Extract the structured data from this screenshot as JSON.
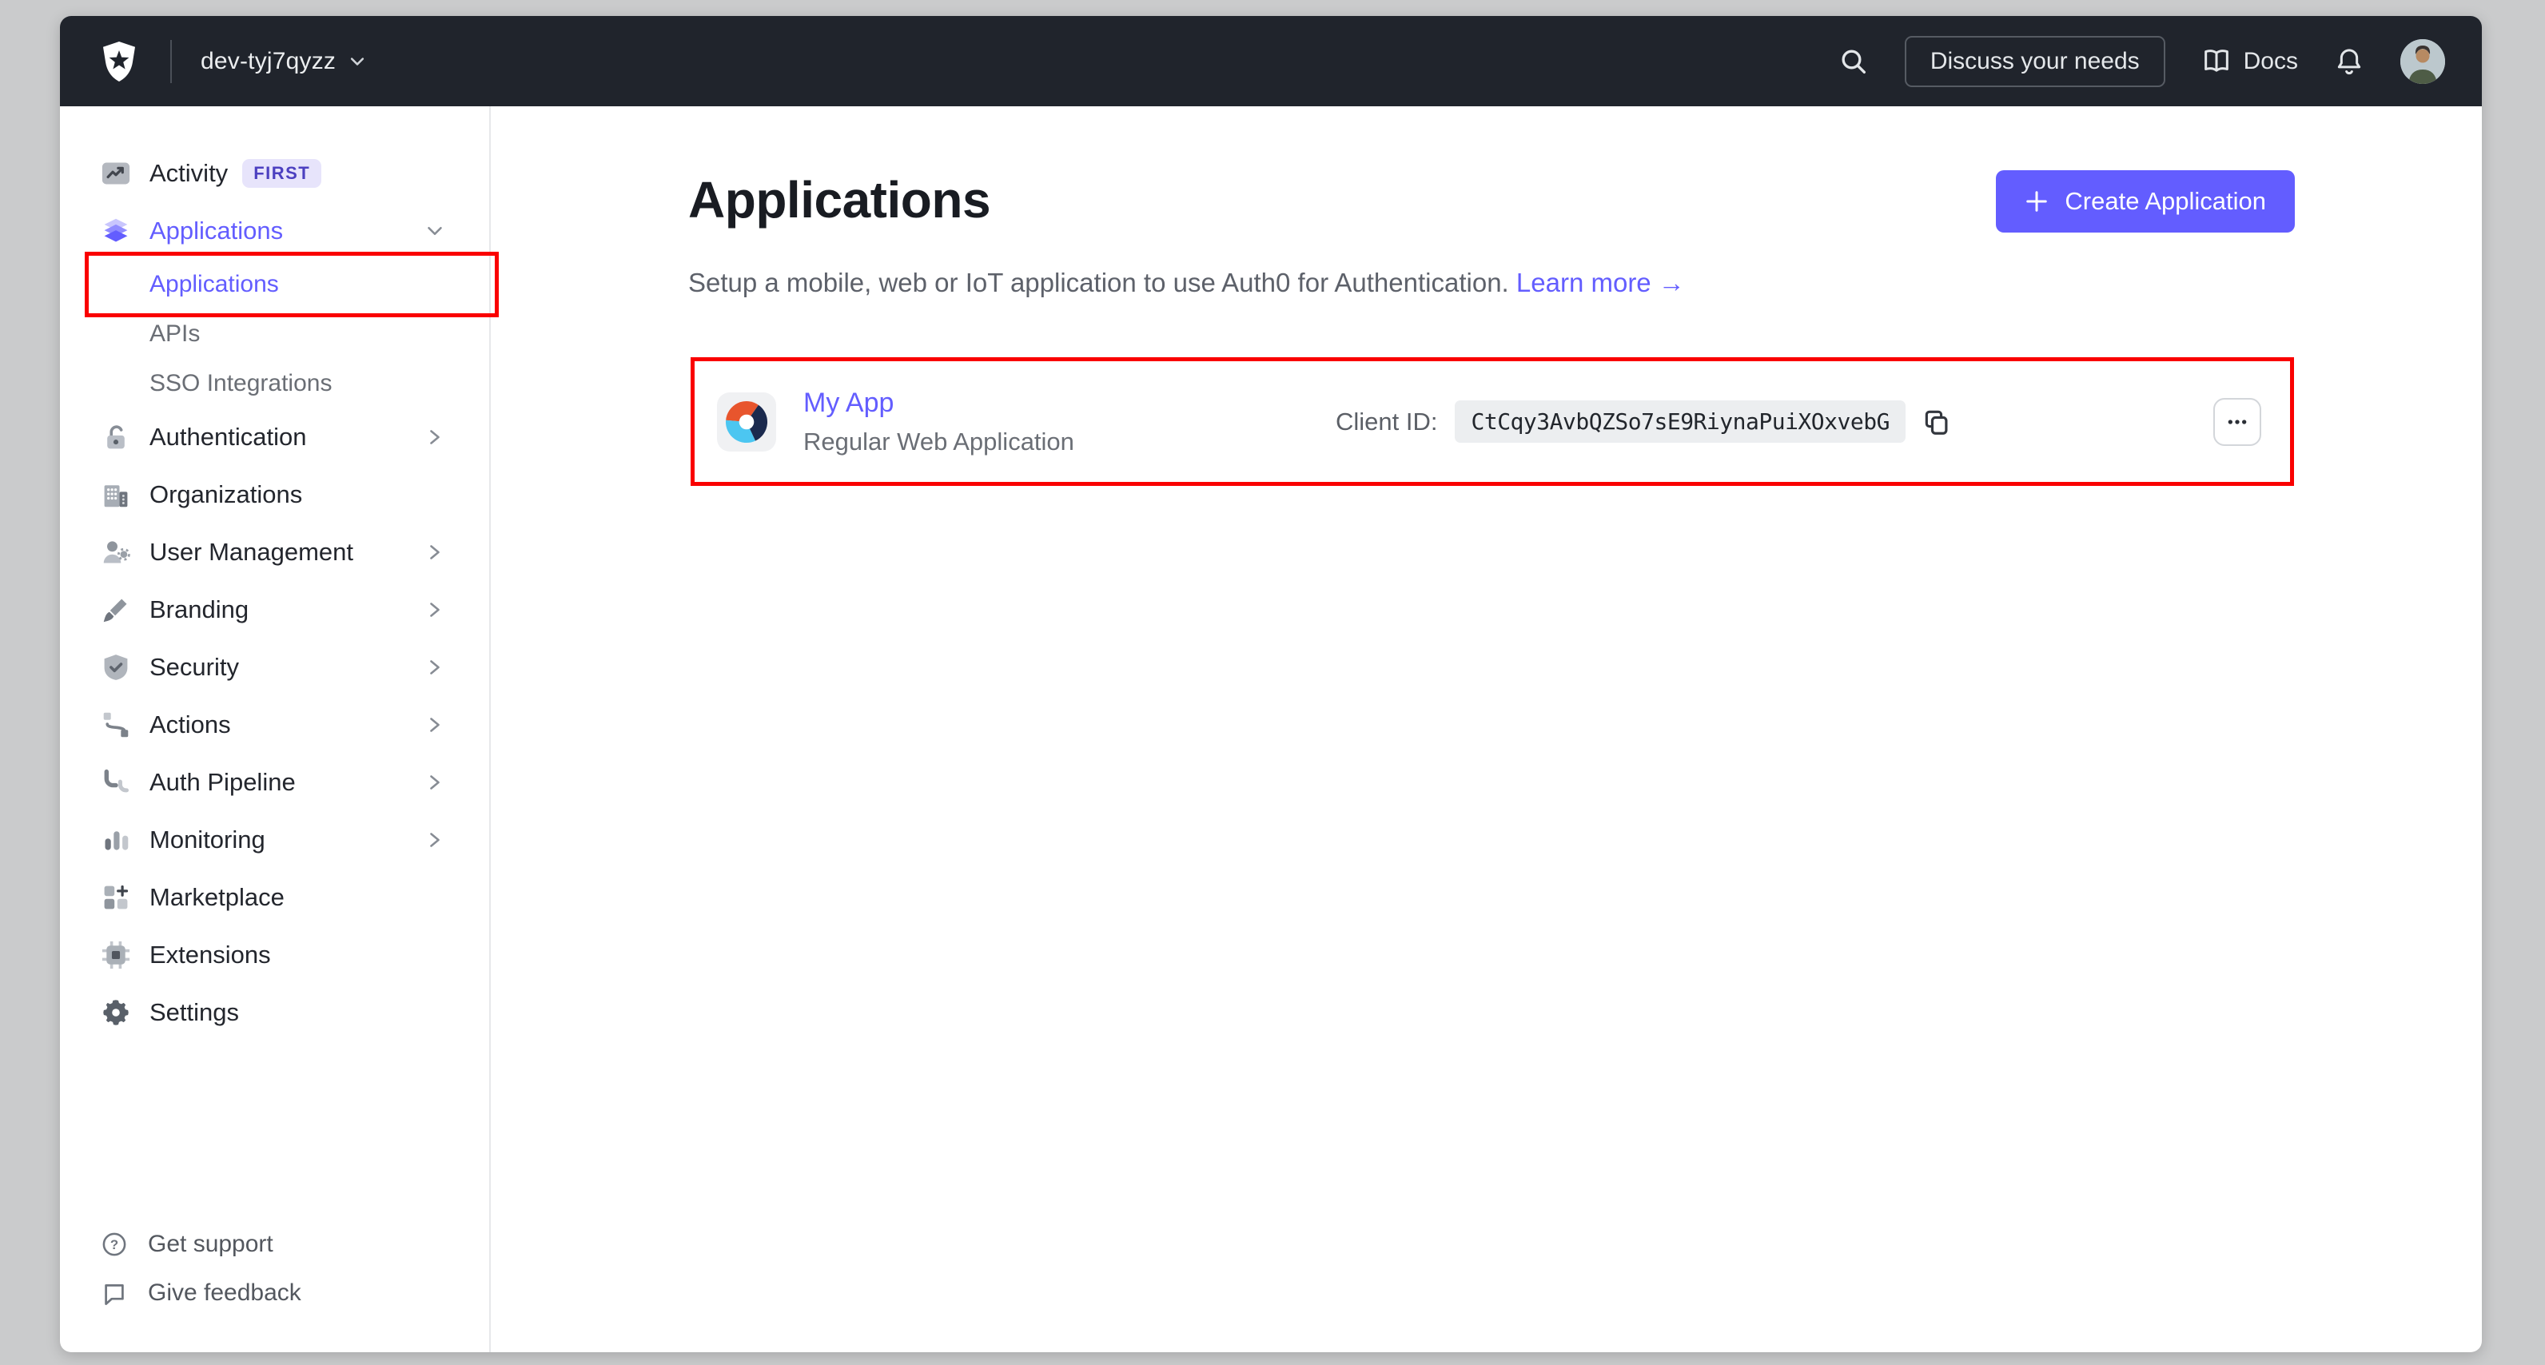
{
  "colors": {
    "accent": "#635dff",
    "topbar_bg": "#20242c",
    "annotation": "#fa0000"
  },
  "topbar": {
    "tenant": "dev-tyj7qyzz",
    "discuss_button": "Discuss your needs",
    "docs_label": "Docs"
  },
  "sidebar": {
    "items": [
      {
        "id": "activity",
        "label": "Activity",
        "icon": "activity-icon",
        "badge": "FIRST"
      },
      {
        "id": "applications",
        "label": "Applications",
        "icon": "applications-icon",
        "chevron": "down",
        "active_parent": true
      },
      {
        "id": "applications-sub",
        "label": "Applications",
        "sub": true,
        "active": true,
        "annotated": true
      },
      {
        "id": "apis",
        "label": "APIs",
        "sub": true
      },
      {
        "id": "sso-integrations",
        "label": "SSO Integrations",
        "sub": true
      },
      {
        "id": "authentication",
        "label": "Authentication",
        "icon": "authentication-icon",
        "chevron": "right"
      },
      {
        "id": "organizations",
        "label": "Organizations",
        "icon": "organizations-icon"
      },
      {
        "id": "user-management",
        "label": "User Management",
        "icon": "user-management-icon",
        "chevron": "right"
      },
      {
        "id": "branding",
        "label": "Branding",
        "icon": "branding-icon",
        "chevron": "right"
      },
      {
        "id": "security",
        "label": "Security",
        "icon": "security-icon",
        "chevron": "right"
      },
      {
        "id": "actions",
        "label": "Actions",
        "icon": "actions-icon",
        "chevron": "right"
      },
      {
        "id": "auth-pipeline",
        "label": "Auth Pipeline",
        "icon": "auth-pipeline-icon",
        "chevron": "right"
      },
      {
        "id": "monitoring",
        "label": "Monitoring",
        "icon": "monitoring-icon",
        "chevron": "right"
      },
      {
        "id": "marketplace",
        "label": "Marketplace",
        "icon": "marketplace-icon"
      },
      {
        "id": "extensions",
        "label": "Extensions",
        "icon": "extensions-icon"
      },
      {
        "id": "settings",
        "label": "Settings",
        "icon": "settings-icon"
      }
    ],
    "footer_items": [
      {
        "id": "get-support",
        "label": "Get support",
        "icon": "help-icon"
      },
      {
        "id": "give-feedback",
        "label": "Give feedback",
        "icon": "feedback-icon"
      }
    ]
  },
  "main": {
    "title": "Applications",
    "subtitle": "Setup a mobile, web or IoT application to use Auth0 for Authentication.",
    "learn_more": "Learn more",
    "learn_more_arrow": "→",
    "create_button": "Create Application",
    "app": {
      "name": "My App",
      "type": "Regular Web Application",
      "client_id_label": "Client ID:",
      "client_id": "CtCqy3AvbQZSo7sE9RiynaPuiXOxvebG"
    }
  }
}
